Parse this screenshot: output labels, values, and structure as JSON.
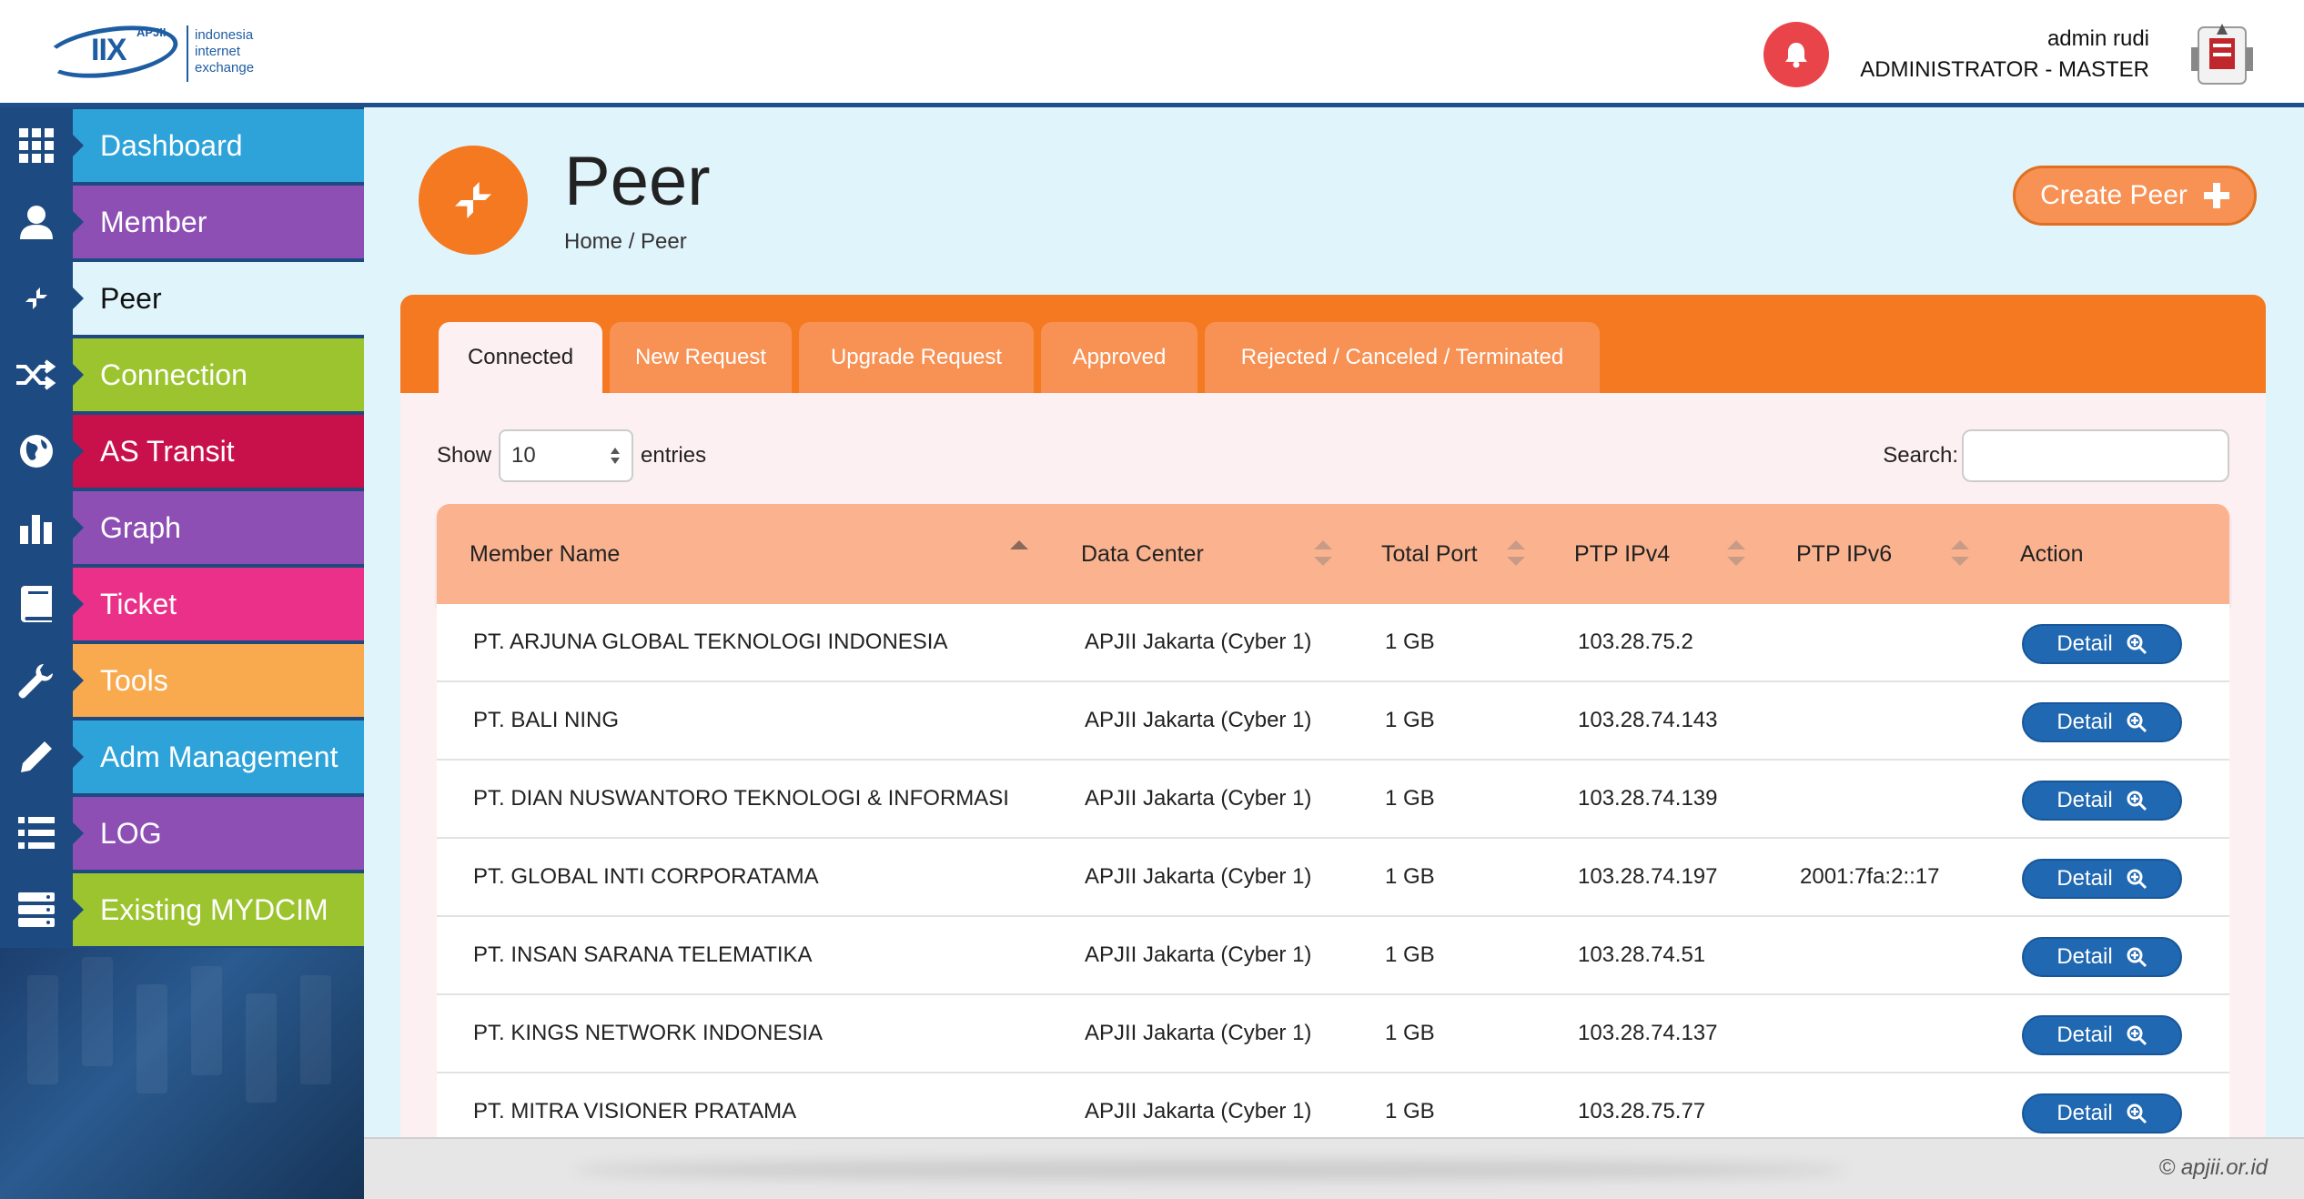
{
  "brand": {
    "logo_mark": "IIX",
    "logo_org": "APJII",
    "logo_lines": [
      "indonesia",
      "internet",
      "exchange"
    ]
  },
  "header": {
    "user_name": "admin rudi",
    "user_role": "ADMINISTRATOR - MASTER",
    "notification_icon": "bell-icon"
  },
  "sidebar": {
    "items": [
      {
        "label": "Dashboard",
        "icon": "grid-icon",
        "color": "#2ea3d9"
      },
      {
        "label": "Member",
        "icon": "user-icon",
        "color": "#8e4fb5"
      },
      {
        "label": "Peer",
        "icon": "compress-arrows-icon",
        "color": "#e0f4fb",
        "active": true
      },
      {
        "label": "Connection",
        "icon": "shuffle-icon",
        "color": "#9cc42f"
      },
      {
        "label": "AS Transit",
        "icon": "globe-icon",
        "color": "#c8104a"
      },
      {
        "label": "Graph",
        "icon": "bar-chart-icon",
        "color": "#8e4fb5"
      },
      {
        "label": "Ticket",
        "icon": "book-icon",
        "color": "#ea3088"
      },
      {
        "label": "Tools",
        "icon": "wrench-icon",
        "color": "#f9aa4e"
      },
      {
        "label": "Adm Management",
        "icon": "pencil-icon",
        "color": "#2ea3d9"
      },
      {
        "label": "LOG",
        "icon": "list-icon",
        "color": "#8e4fb5"
      },
      {
        "label": "Existing MYDCIM",
        "icon": "server-icon",
        "color": "#9cc42f"
      }
    ]
  },
  "page": {
    "title": "Peer",
    "breadcrumb": "Home / Peer",
    "create_label": "Create Peer",
    "accent": "#f47920"
  },
  "tabs": [
    "Connected",
    "New Request",
    "Upgrade Request",
    "Approved",
    "Rejected / Canceled / Terminated"
  ],
  "table_controls": {
    "show_label": "Show",
    "entries_value": "10",
    "entries_label": "entries",
    "search_label": "Search:"
  },
  "table": {
    "columns": [
      "Member Name",
      "Data Center",
      "Total Port",
      "PTP IPv4",
      "PTP IPv6",
      "Action"
    ],
    "detail_label": "Detail",
    "rows": [
      {
        "member": "PT. ARJUNA GLOBAL TEKNOLOGI INDONESIA",
        "dc": "APJII Jakarta (Cyber 1)",
        "port": "1 GB",
        "ipv4": "103.28.75.2",
        "ipv6": ""
      },
      {
        "member": "PT. BALI NING",
        "dc": "APJII Jakarta (Cyber 1)",
        "port": "1 GB",
        "ipv4": "103.28.74.143",
        "ipv6": ""
      },
      {
        "member": "PT. DIAN NUSWANTORO TEKNOLOGI & INFORMASI",
        "dc": "APJII Jakarta (Cyber 1)",
        "port": "1 GB",
        "ipv4": "103.28.74.139",
        "ipv6": ""
      },
      {
        "member": "PT. GLOBAL INTI CORPORATAMA",
        "dc": "APJII Jakarta (Cyber 1)",
        "port": "1 GB",
        "ipv4": "103.28.74.197",
        "ipv6": "2001:7fa:2::17"
      },
      {
        "member": "PT. INSAN SARANA TELEMATIKA",
        "dc": "APJII Jakarta (Cyber 1)",
        "port": "1 GB",
        "ipv4": "103.28.74.51",
        "ipv6": ""
      },
      {
        "member": "PT. KINGS NETWORK INDONESIA",
        "dc": "APJII Jakarta (Cyber 1)",
        "port": "1 GB",
        "ipv4": "103.28.74.137",
        "ipv6": ""
      },
      {
        "member": "PT. MITRA VISIONER PRATAMA",
        "dc": "APJII Jakarta (Cyber 1)",
        "port": "1 GB",
        "ipv4": "103.28.75.77",
        "ipv6": ""
      }
    ]
  },
  "footer": {
    "text": "© apjii.or.id"
  }
}
